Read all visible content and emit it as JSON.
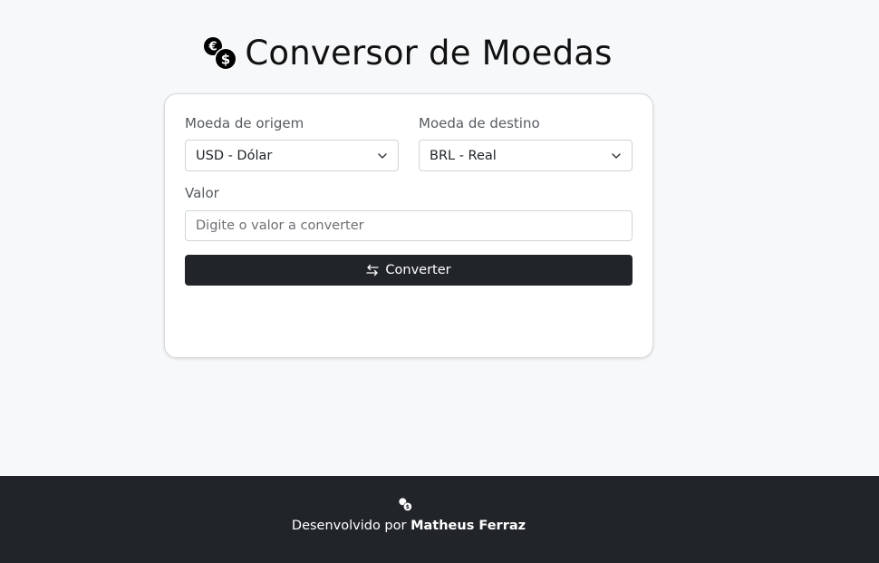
{
  "header": {
    "title": "Conversor de Moedas",
    "icon": "coins-icon"
  },
  "form": {
    "origin": {
      "label": "Moeda de origem",
      "selected": "USD - Dólar"
    },
    "destination": {
      "label": "Moeda de destino",
      "selected": "BRL - Real"
    },
    "amount": {
      "label": "Valor",
      "placeholder": "Digite o valor a converter",
      "value": ""
    },
    "convert_button": {
      "label": "Converter",
      "icon": "swap-arrows-icon"
    }
  },
  "footer": {
    "prefix": "Desenvolvido por ",
    "author": "Matheus Ferraz",
    "icon": "coins-icon"
  },
  "colors": {
    "background": "#f7f8fa",
    "card": "#ffffff",
    "dark": "#212529",
    "border": "#ced4da"
  }
}
